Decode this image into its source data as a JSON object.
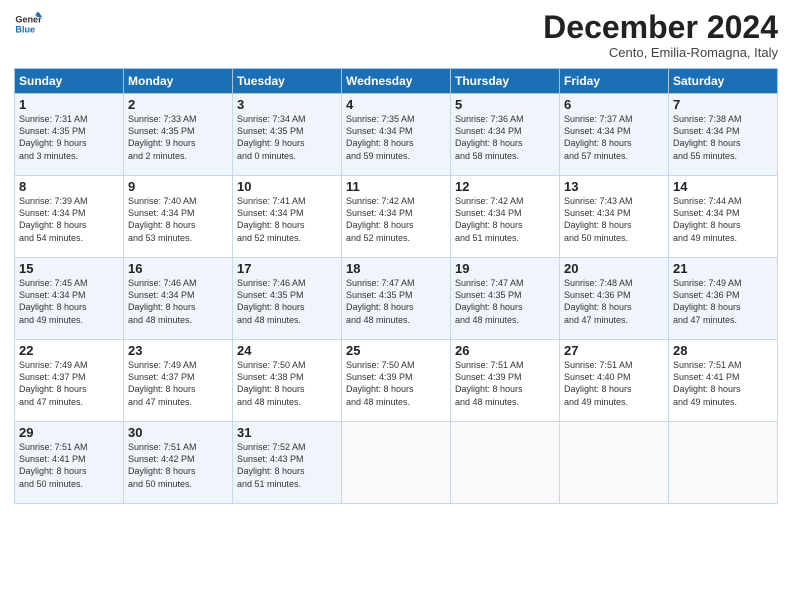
{
  "header": {
    "logo_line1": "General",
    "logo_line2": "Blue",
    "month": "December 2024",
    "location": "Cento, Emilia-Romagna, Italy"
  },
  "weekdays": [
    "Sunday",
    "Monday",
    "Tuesday",
    "Wednesday",
    "Thursday",
    "Friday",
    "Saturday"
  ],
  "weeks": [
    [
      {
        "day": "1",
        "lines": [
          "Sunrise: 7:31 AM",
          "Sunset: 4:35 PM",
          "Daylight: 9 hours",
          "and 3 minutes."
        ]
      },
      {
        "day": "2",
        "lines": [
          "Sunrise: 7:33 AM",
          "Sunset: 4:35 PM",
          "Daylight: 9 hours",
          "and 2 minutes."
        ]
      },
      {
        "day": "3",
        "lines": [
          "Sunrise: 7:34 AM",
          "Sunset: 4:35 PM",
          "Daylight: 9 hours",
          "and 0 minutes."
        ]
      },
      {
        "day": "4",
        "lines": [
          "Sunrise: 7:35 AM",
          "Sunset: 4:34 PM",
          "Daylight: 8 hours",
          "and 59 minutes."
        ]
      },
      {
        "day": "5",
        "lines": [
          "Sunrise: 7:36 AM",
          "Sunset: 4:34 PM",
          "Daylight: 8 hours",
          "and 58 minutes."
        ]
      },
      {
        "day": "6",
        "lines": [
          "Sunrise: 7:37 AM",
          "Sunset: 4:34 PM",
          "Daylight: 8 hours",
          "and 57 minutes."
        ]
      },
      {
        "day": "7",
        "lines": [
          "Sunrise: 7:38 AM",
          "Sunset: 4:34 PM",
          "Daylight: 8 hours",
          "and 55 minutes."
        ]
      }
    ],
    [
      {
        "day": "8",
        "lines": [
          "Sunrise: 7:39 AM",
          "Sunset: 4:34 PM",
          "Daylight: 8 hours",
          "and 54 minutes."
        ]
      },
      {
        "day": "9",
        "lines": [
          "Sunrise: 7:40 AM",
          "Sunset: 4:34 PM",
          "Daylight: 8 hours",
          "and 53 minutes."
        ]
      },
      {
        "day": "10",
        "lines": [
          "Sunrise: 7:41 AM",
          "Sunset: 4:34 PM",
          "Daylight: 8 hours",
          "and 52 minutes."
        ]
      },
      {
        "day": "11",
        "lines": [
          "Sunrise: 7:42 AM",
          "Sunset: 4:34 PM",
          "Daylight: 8 hours",
          "and 52 minutes."
        ]
      },
      {
        "day": "12",
        "lines": [
          "Sunrise: 7:42 AM",
          "Sunset: 4:34 PM",
          "Daylight: 8 hours",
          "and 51 minutes."
        ]
      },
      {
        "day": "13",
        "lines": [
          "Sunrise: 7:43 AM",
          "Sunset: 4:34 PM",
          "Daylight: 8 hours",
          "and 50 minutes."
        ]
      },
      {
        "day": "14",
        "lines": [
          "Sunrise: 7:44 AM",
          "Sunset: 4:34 PM",
          "Daylight: 8 hours",
          "and 49 minutes."
        ]
      }
    ],
    [
      {
        "day": "15",
        "lines": [
          "Sunrise: 7:45 AM",
          "Sunset: 4:34 PM",
          "Daylight: 8 hours",
          "and 49 minutes."
        ]
      },
      {
        "day": "16",
        "lines": [
          "Sunrise: 7:46 AM",
          "Sunset: 4:34 PM",
          "Daylight: 8 hours",
          "and 48 minutes."
        ]
      },
      {
        "day": "17",
        "lines": [
          "Sunrise: 7:46 AM",
          "Sunset: 4:35 PM",
          "Daylight: 8 hours",
          "and 48 minutes."
        ]
      },
      {
        "day": "18",
        "lines": [
          "Sunrise: 7:47 AM",
          "Sunset: 4:35 PM",
          "Daylight: 8 hours",
          "and 48 minutes."
        ]
      },
      {
        "day": "19",
        "lines": [
          "Sunrise: 7:47 AM",
          "Sunset: 4:35 PM",
          "Daylight: 8 hours",
          "and 48 minutes."
        ]
      },
      {
        "day": "20",
        "lines": [
          "Sunrise: 7:48 AM",
          "Sunset: 4:36 PM",
          "Daylight: 8 hours",
          "and 47 minutes."
        ]
      },
      {
        "day": "21",
        "lines": [
          "Sunrise: 7:49 AM",
          "Sunset: 4:36 PM",
          "Daylight: 8 hours",
          "and 47 minutes."
        ]
      }
    ],
    [
      {
        "day": "22",
        "lines": [
          "Sunrise: 7:49 AM",
          "Sunset: 4:37 PM",
          "Daylight: 8 hours",
          "and 47 minutes."
        ]
      },
      {
        "day": "23",
        "lines": [
          "Sunrise: 7:49 AM",
          "Sunset: 4:37 PM",
          "Daylight: 8 hours",
          "and 47 minutes."
        ]
      },
      {
        "day": "24",
        "lines": [
          "Sunrise: 7:50 AM",
          "Sunset: 4:38 PM",
          "Daylight: 8 hours",
          "and 48 minutes."
        ]
      },
      {
        "day": "25",
        "lines": [
          "Sunrise: 7:50 AM",
          "Sunset: 4:39 PM",
          "Daylight: 8 hours",
          "and 48 minutes."
        ]
      },
      {
        "day": "26",
        "lines": [
          "Sunrise: 7:51 AM",
          "Sunset: 4:39 PM",
          "Daylight: 8 hours",
          "and 48 minutes."
        ]
      },
      {
        "day": "27",
        "lines": [
          "Sunrise: 7:51 AM",
          "Sunset: 4:40 PM",
          "Daylight: 8 hours",
          "and 49 minutes."
        ]
      },
      {
        "day": "28",
        "lines": [
          "Sunrise: 7:51 AM",
          "Sunset: 4:41 PM",
          "Daylight: 8 hours",
          "and 49 minutes."
        ]
      }
    ],
    [
      {
        "day": "29",
        "lines": [
          "Sunrise: 7:51 AM",
          "Sunset: 4:41 PM",
          "Daylight: 8 hours",
          "and 50 minutes."
        ]
      },
      {
        "day": "30",
        "lines": [
          "Sunrise: 7:51 AM",
          "Sunset: 4:42 PM",
          "Daylight: 8 hours",
          "and 50 minutes."
        ]
      },
      {
        "day": "31",
        "lines": [
          "Sunrise: 7:52 AM",
          "Sunset: 4:43 PM",
          "Daylight: 8 hours",
          "and 51 minutes."
        ]
      },
      {
        "day": "",
        "lines": []
      },
      {
        "day": "",
        "lines": []
      },
      {
        "day": "",
        "lines": []
      },
      {
        "day": "",
        "lines": []
      }
    ]
  ]
}
